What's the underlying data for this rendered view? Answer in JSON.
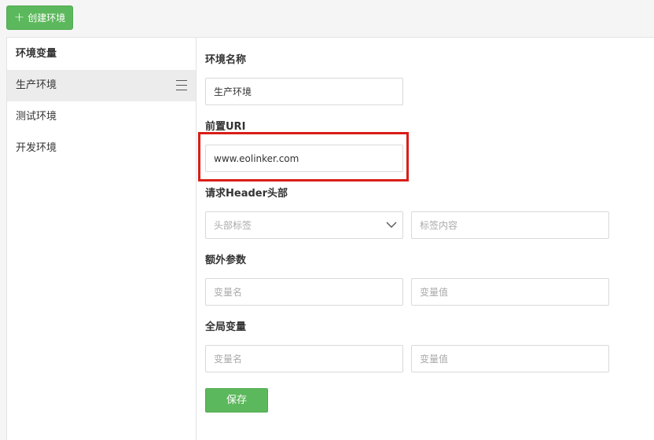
{
  "toolbar": {
    "create_label": "创建环境",
    "create_icon": "plus-icon"
  },
  "sidebar": {
    "title": "环境变量",
    "items": [
      {
        "label": "生产环境",
        "active": true
      },
      {
        "label": "测试环境",
        "active": false
      },
      {
        "label": "开发环境",
        "active": false
      }
    ]
  },
  "form": {
    "env_name": {
      "label": "环境名称",
      "value": "生产环境"
    },
    "front_uri": {
      "label": "前置URI",
      "value": "www.eolinker.com"
    },
    "header": {
      "label": "请求Header头部",
      "key_placeholder": "头部标签",
      "value_placeholder": "标签内容"
    },
    "extra_params": {
      "label": "额外参数",
      "key_placeholder": "变量名",
      "value_placeholder": "变量值"
    },
    "global_vars": {
      "label": "全局变量",
      "key_placeholder": "变量名",
      "value_placeholder": "变量值"
    },
    "save_label": "保存"
  },
  "colors": {
    "accent": "#5cb85c",
    "highlight": "#d91e18"
  }
}
